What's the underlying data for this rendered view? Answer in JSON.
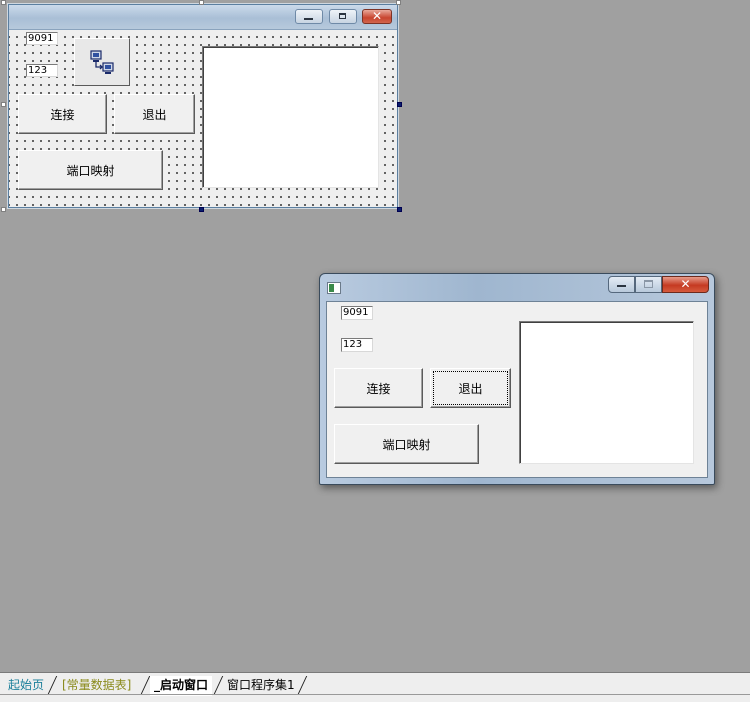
{
  "designer_form": {
    "port_field": "9091",
    "id_field": "123",
    "connect_button": "连接",
    "exit_button": "退出",
    "port_map_button": "端口映射",
    "socket_component_icon": "network-component-icon"
  },
  "running_window": {
    "port_field": "9091",
    "id_field": "123",
    "connect_button": "连接",
    "exit_button": "退出",
    "port_map_button": "端口映射",
    "app_icon": "window-app-icon"
  },
  "tabs": [
    {
      "label": "起始页",
      "color": "#1a7f9a"
    },
    {
      "label": "[常量数据表]",
      "color": "#8a8a1a"
    },
    {
      "label": "_启动窗口",
      "color": "#000000",
      "active": true
    },
    {
      "label": "窗口程序集1",
      "color": "#000000"
    }
  ],
  "colors": {
    "workspace": "#a0a0a0",
    "selection_handle": "#0a1e6e",
    "close_button": "#c8452f"
  }
}
